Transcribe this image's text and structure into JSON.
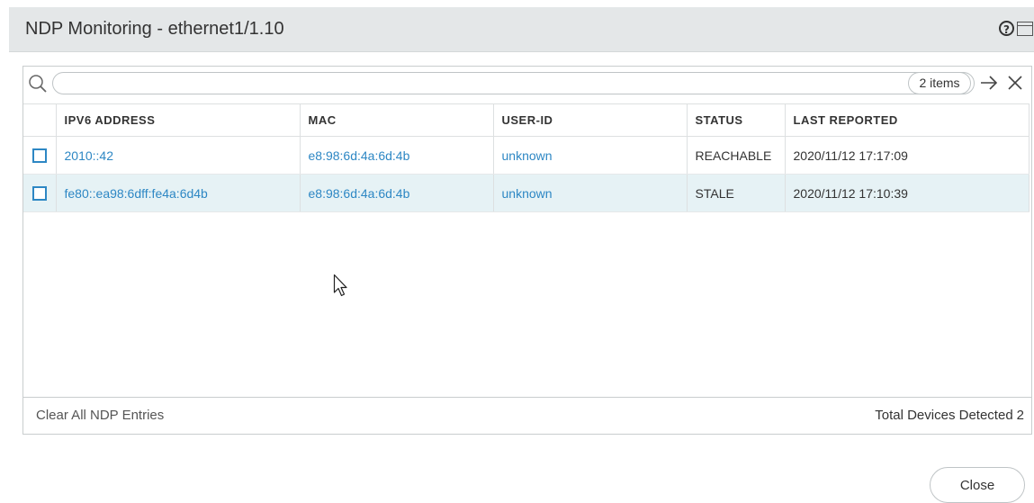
{
  "dialog": {
    "title": "NDP Monitoring - ethernet1/1.10",
    "help_icon": "?",
    "help_icon_name": "help-icon",
    "window_icon_name": "window-icon"
  },
  "search": {
    "value": "",
    "placeholder": "",
    "items_count": "2 items",
    "icon": "search-icon",
    "go_icon": "arrow-right-icon",
    "clear_icon": "close-icon"
  },
  "table": {
    "headers": {
      "ipv6": "IPV6 ADDRESS",
      "mac": "MAC",
      "user_id": "USER-ID",
      "status": "STATUS",
      "last_reported": "LAST REPORTED"
    },
    "rows": [
      {
        "ipv6": "2010::42",
        "mac": "e8:98:6d:4a:6d:4b",
        "user_id": "unknown",
        "status": "REACHABLE",
        "last_reported": "2020/11/12 17:17:09"
      },
      {
        "ipv6": "fe80::ea98:6dff:fe4a:6d4b",
        "mac": "e8:98:6d:4a:6d:4b",
        "user_id": "unknown",
        "status": "STALE",
        "last_reported": "2020/11/12 17:10:39"
      }
    ]
  },
  "footer": {
    "clear_all": "Clear All NDP Entries",
    "total_label": "Total Devices Detected",
    "total_count": "2"
  },
  "close_label": "Close",
  "colors": {
    "header_bg": "#e4e7e8",
    "link": "#2d87c4",
    "row_alt": "#e6f2f5"
  }
}
